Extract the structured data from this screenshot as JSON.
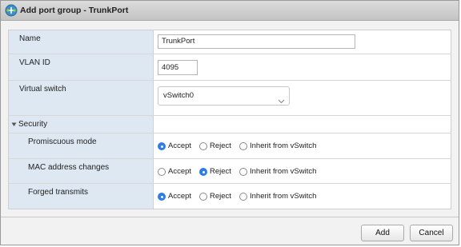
{
  "dialog": {
    "title": "Add port group - TrunkPort",
    "title_icon": "port-group-icon"
  },
  "form": {
    "name": {
      "label": "Name",
      "value": "TrunkPort"
    },
    "vlan_id": {
      "label": "VLAN ID",
      "value": "4095"
    },
    "virtual_switch": {
      "label": "Virtual switch",
      "value": "vSwitch0"
    },
    "security": {
      "label": "Security",
      "expanded": true,
      "options": [
        "Accept",
        "Reject",
        "Inherit from vSwitch"
      ],
      "promiscuous_mode": {
        "label": "Promiscuous mode",
        "selected": "Accept"
      },
      "mac_address_changes": {
        "label": "MAC address changes",
        "selected": "Reject"
      },
      "forged_transmits": {
        "label": "Forged transmits",
        "selected": "Accept"
      }
    }
  },
  "buttons": {
    "add": "Add",
    "cancel": "Cancel"
  },
  "colors": {
    "label_bg": "#dde8f2",
    "radio_selected": "#2f7de1"
  }
}
